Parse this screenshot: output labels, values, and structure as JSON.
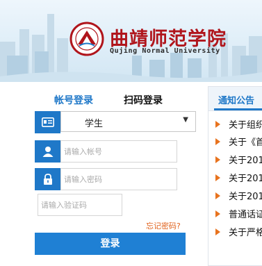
{
  "header": {
    "school_name_cn": "曲靖师范学院",
    "school_name_en": "Qujing Normal University",
    "logo_icon": "university-seal-icon"
  },
  "login": {
    "tabs": [
      {
        "label": "帐号登录",
        "active": true
      },
      {
        "label": "扫码登录",
        "active": false
      }
    ],
    "user_type": {
      "selected": "学生",
      "icon": "id-card-icon"
    },
    "account": {
      "placeholder": "请输入帐号",
      "icon": "user-icon"
    },
    "password": {
      "placeholder": "请输入密码",
      "icon": "lock-icon"
    },
    "captcha": {
      "placeholder": "请输入验证码"
    },
    "forgot_label": "忘记密码?",
    "submit_label": "登录"
  },
  "notices": {
    "title": "通知公告",
    "items": [
      {
        "text": "关于组织"
      },
      {
        "text": "关于《首"
      },
      {
        "text": "关于201"
      },
      {
        "text": "关于201"
      },
      {
        "text": "关于201"
      },
      {
        "text": "普通话证"
      },
      {
        "text": "关于严格"
      }
    ]
  },
  "colors": {
    "primary": "#1f78c8",
    "brand_red": "#b0151c",
    "link_orange": "#e0621c",
    "bullet_orange": "#e8731e"
  }
}
